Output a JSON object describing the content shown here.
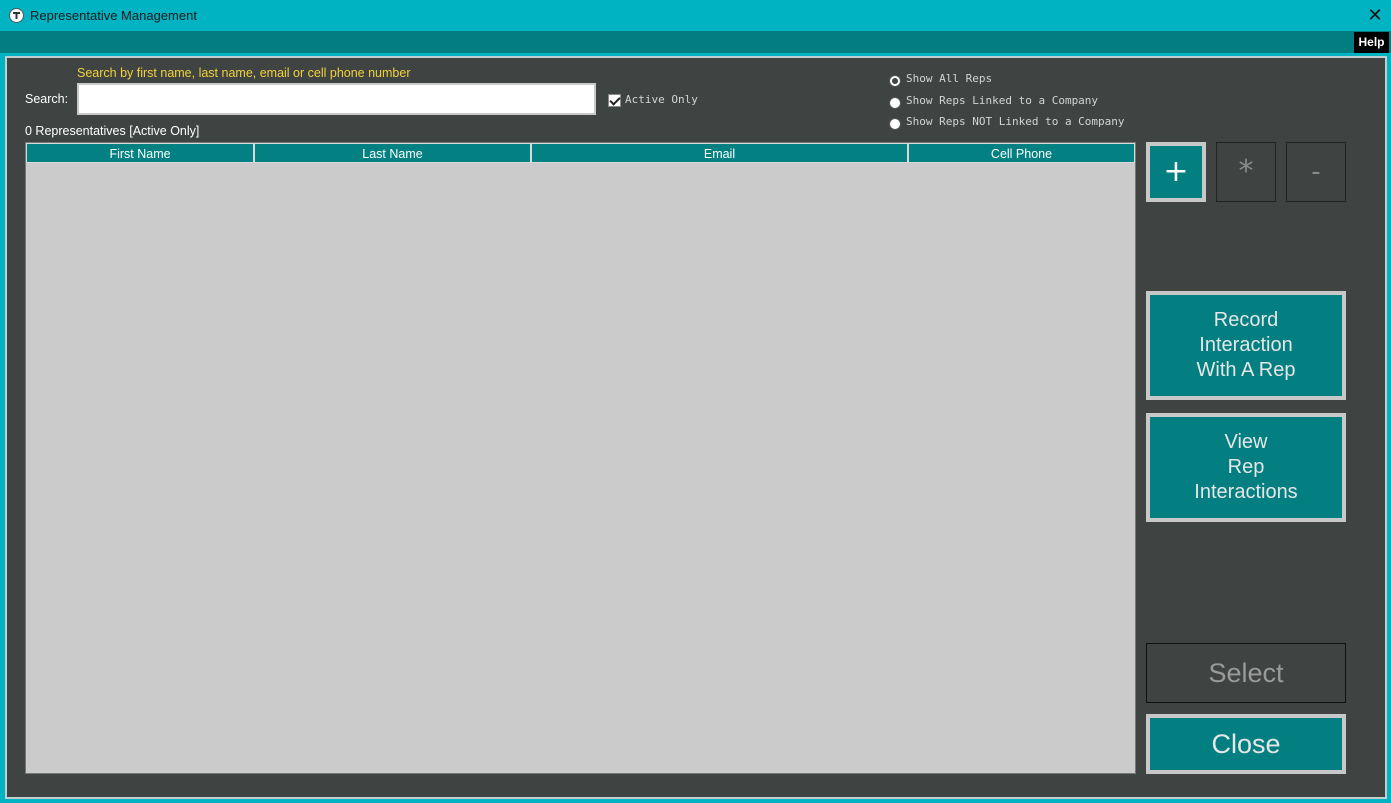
{
  "window": {
    "title": "Representative Management",
    "close_glyph": "✕",
    "icon": "app-icon"
  },
  "help": {
    "label": "Help"
  },
  "search": {
    "hint": "Search by first name, last name, email or cell phone number",
    "label": "Search:",
    "value": "",
    "placeholder": ""
  },
  "active_only": {
    "label": "Active Only",
    "checked": true
  },
  "filters": [
    {
      "label": "Show All Reps",
      "selected": true
    },
    {
      "label": "Show Reps Linked to a Company",
      "selected": false
    },
    {
      "label": "Show Reps NOT Linked to a Company",
      "selected": false
    }
  ],
  "count_text": "0 Representatives [Active Only]",
  "table": {
    "columns": [
      "First Name",
      "Last Name",
      "Email",
      "Cell Phone"
    ],
    "rows": []
  },
  "actions": {
    "add": "+",
    "edit": "*",
    "delete": "-",
    "record": "Record\nInteraction\nWith A Rep",
    "view": "View\nRep\nInteractions",
    "select": "Select",
    "close": "Close"
  },
  "colors": {
    "accent": "#037f81",
    "panel": "#3f4443",
    "title": "#00b3c2",
    "hint": "#f1d23a"
  }
}
